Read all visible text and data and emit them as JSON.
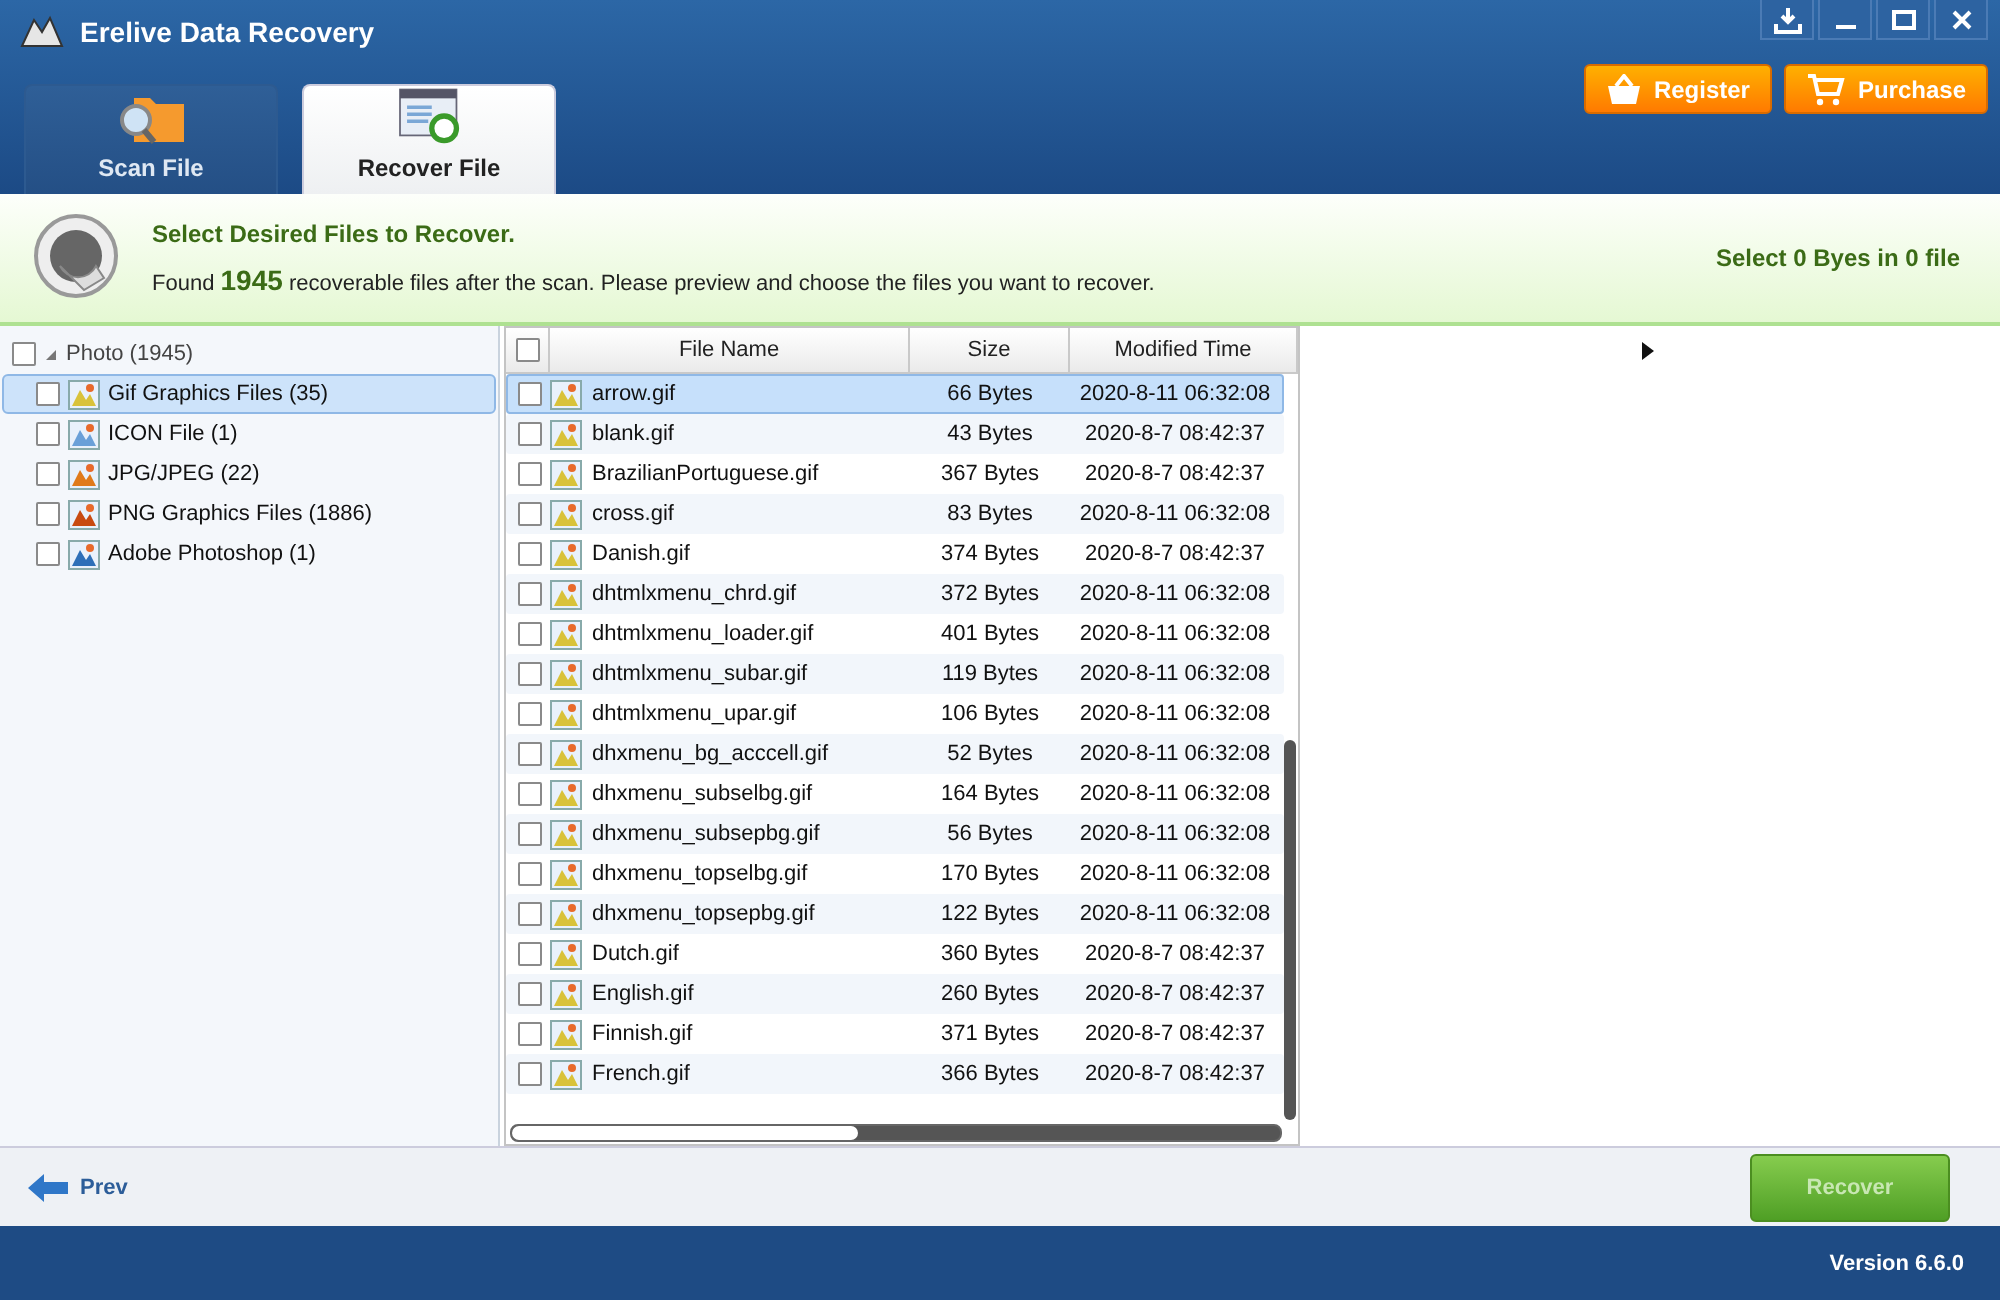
{
  "window": {
    "title": "Erelive Data Recovery"
  },
  "header_buttons": [
    {
      "label": "Register",
      "kind": "basket"
    },
    {
      "label": "Purchase",
      "kind": "cart"
    }
  ],
  "tabs": [
    {
      "label": "Scan File",
      "kind": "scan",
      "selected": false
    },
    {
      "label": "Recover File",
      "kind": "recover",
      "selected": true
    }
  ],
  "info": {
    "heading": "Select Desired Files to Recover.",
    "message": "Found **1945** recoverable files after the scan. Please preview and choose the files you want to recover.",
    "selection": "Select 0 Byes in 0 file"
  },
  "tree": [
    {
      "label": "Photo (1945)",
      "checked": false,
      "expanded": true,
      "selected": false,
      "children": [
        {
          "label": "Gif Graphics Files (35)",
          "checked": false,
          "selected": true,
          "kind": "gif"
        },
        {
          "label": "ICON File (1)",
          "checked": false,
          "selected": false,
          "kind": "icon"
        },
        {
          "label": "JPG/JPEG (22)",
          "checked": false,
          "selected": false,
          "kind": "jpg"
        },
        {
          "label": "PNG Graphics Files (1886)",
          "checked": false,
          "selected": false,
          "kind": "png"
        },
        {
          "label": "Adobe Photoshop (1)",
          "checked": false,
          "selected": false,
          "kind": "psd"
        }
      ]
    }
  ],
  "table": {
    "all_checked": false,
    "columns": [
      "File Name",
      "Size",
      "Modified Time"
    ],
    "rows": [
      {
        "name": "arrow.gif",
        "size": "66 Bytes",
        "modified": "2020-8-11 06:32:08",
        "checked": false,
        "selected": true
      },
      {
        "name": "blank.gif",
        "size": "43 Bytes",
        "modified": "2020-8-7 08:42:37",
        "checked": false,
        "selected": false
      },
      {
        "name": "BrazilianPortuguese.gif",
        "size": "367 Bytes",
        "modified": "2020-8-7 08:42:37",
        "checked": false,
        "selected": false
      },
      {
        "name": "cross.gif",
        "size": "83 Bytes",
        "modified": "2020-8-11 06:32:08",
        "checked": false,
        "selected": false
      },
      {
        "name": "Danish.gif",
        "size": "374 Bytes",
        "modified": "2020-8-7 08:42:37",
        "checked": false,
        "selected": false
      },
      {
        "name": "dhtmlxmenu_chrd.gif",
        "size": "372 Bytes",
        "modified": "2020-8-11 06:32:08",
        "checked": false,
        "selected": false
      },
      {
        "name": "dhtmlxmenu_loader.gif",
        "size": "401 Bytes",
        "modified": "2020-8-11 06:32:08",
        "checked": false,
        "selected": false
      },
      {
        "name": "dhtmlxmenu_subar.gif",
        "size": "119 Bytes",
        "modified": "2020-8-11 06:32:08",
        "checked": false,
        "selected": false
      },
      {
        "name": "dhtmlxmenu_upar.gif",
        "size": "106 Bytes",
        "modified": "2020-8-11 06:32:08",
        "checked": false,
        "selected": false
      },
      {
        "name": "dhxmenu_bg_acccell.gif",
        "size": "52 Bytes",
        "modified": "2020-8-11 06:32:08",
        "checked": false,
        "selected": false
      },
      {
        "name": "dhxmenu_subselbg.gif",
        "size": "164 Bytes",
        "modified": "2020-8-11 06:32:08",
        "checked": false,
        "selected": false
      },
      {
        "name": "dhxmenu_subsepbg.gif",
        "size": "56 Bytes",
        "modified": "2020-8-11 06:32:08",
        "checked": false,
        "selected": false
      },
      {
        "name": "dhxmenu_topselbg.gif",
        "size": "170 Bytes",
        "modified": "2020-8-11 06:32:08",
        "checked": false,
        "selected": false
      },
      {
        "name": "dhxmenu_topsepbg.gif",
        "size": "122 Bytes",
        "modified": "2020-8-11 06:32:08",
        "checked": false,
        "selected": false
      },
      {
        "name": "Dutch.gif",
        "size": "360 Bytes",
        "modified": "2020-8-7 08:42:37",
        "checked": false,
        "selected": false
      },
      {
        "name": "English.gif",
        "size": "260 Bytes",
        "modified": "2020-8-7 08:42:37",
        "checked": false,
        "selected": false
      },
      {
        "name": "Finnish.gif",
        "size": "371 Bytes",
        "modified": "2020-8-7 08:42:37",
        "checked": false,
        "selected": false
      },
      {
        "name": "French.gif",
        "size": "366 Bytes",
        "modified": "2020-8-7 08:42:37",
        "checked": false,
        "selected": false
      }
    ]
  },
  "footer": {
    "prev": "Prev",
    "recover": {
      "label": "Recover",
      "disabled": true
    }
  },
  "status_bar": {
    "version": "Version 6.6.0"
  }
}
